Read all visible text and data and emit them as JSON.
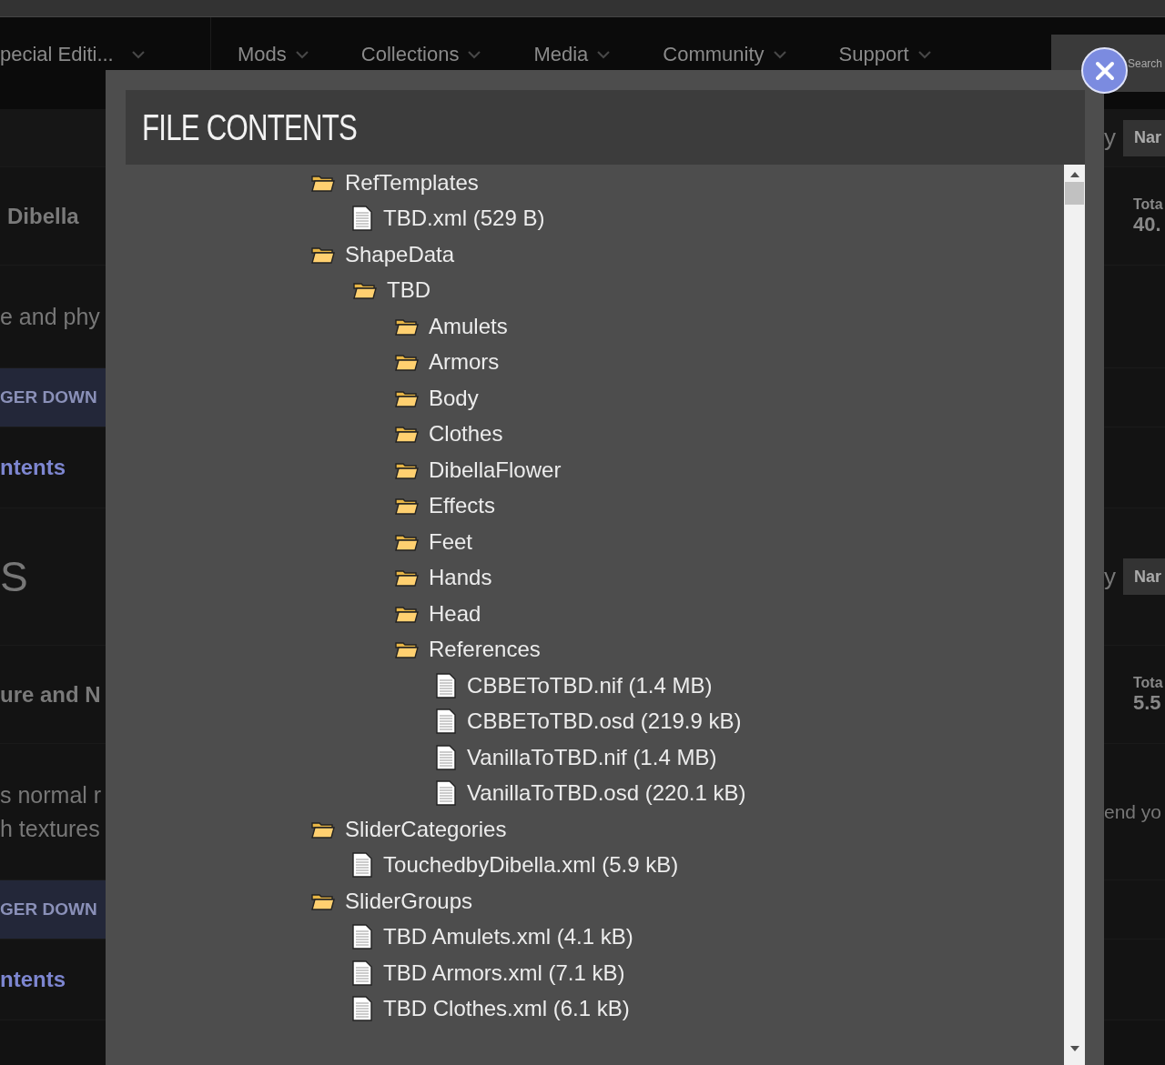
{
  "nav": {
    "items": [
      {
        "label": "pecial Editi..."
      },
      {
        "label": "Mods"
      },
      {
        "label": "Collections"
      },
      {
        "label": "Media"
      },
      {
        "label": "Community"
      },
      {
        "label": "Support"
      }
    ],
    "search": {
      "placeholder": "Search"
    }
  },
  "sections": [
    {
      "sort_label": "y",
      "sort_value": "Nar",
      "card": {
        "title": "Dibella",
        "total_label": "Tota",
        "total_value": "40.",
        "description": [
          "e and phy"
        ],
        "button": "GER DOWN",
        "link": "ntents"
      }
    },
    {
      "heading": "S",
      "sort_label": "y",
      "sort_value": "Nar",
      "card": {
        "title": "ure and N",
        "total_label": "Tota",
        "total_value": "5.5",
        "description": [
          "s normal r",
          "h textures"
        ],
        "side_text": "end yo",
        "button": "GER DOWN",
        "link": "ntents"
      }
    }
  ],
  "modal": {
    "title": "FILE CONTENTS",
    "tree": [
      {
        "kind": "folder",
        "name": "RefTemplates",
        "children": [
          {
            "kind": "file",
            "name": "TBD.xml (529 B)"
          }
        ]
      },
      {
        "kind": "folder",
        "name": "ShapeData",
        "children": [
          {
            "kind": "folder",
            "name": "TBD",
            "children": [
              {
                "kind": "folder",
                "name": "Amulets"
              },
              {
                "kind": "folder",
                "name": "Armors"
              },
              {
                "kind": "folder",
                "name": "Body"
              },
              {
                "kind": "folder",
                "name": "Clothes"
              },
              {
                "kind": "folder",
                "name": "DibellaFlower"
              },
              {
                "kind": "folder",
                "name": "Effects"
              },
              {
                "kind": "folder",
                "name": "Feet"
              },
              {
                "kind": "folder",
                "name": "Hands"
              },
              {
                "kind": "folder",
                "name": "Head"
              },
              {
                "kind": "folder",
                "name": "References",
                "children": [
                  {
                    "kind": "file",
                    "name": "CBBEToTBD.nif (1.4 MB)"
                  },
                  {
                    "kind": "file",
                    "name": "CBBEToTBD.osd (219.9 kB)"
                  },
                  {
                    "kind": "file",
                    "name": "VanillaToTBD.nif (1.4 MB)"
                  },
                  {
                    "kind": "file",
                    "name": "VanillaToTBD.osd (220.1 kB)"
                  }
                ]
              }
            ]
          }
        ]
      },
      {
        "kind": "folder",
        "name": "SliderCategories",
        "children": [
          {
            "kind": "file",
            "name": "TouchedbyDibella.xml (5.9 kB)"
          }
        ]
      },
      {
        "kind": "folder",
        "name": "SliderGroups",
        "children": [
          {
            "kind": "file",
            "name": "TBD Amulets.xml (4.1 kB)"
          },
          {
            "kind": "file",
            "name": "TBD Armors.xml (7.1 kB)"
          },
          {
            "kind": "file",
            "name": "TBD Clothes.xml (6.1 kB)"
          }
        ]
      }
    ]
  }
}
